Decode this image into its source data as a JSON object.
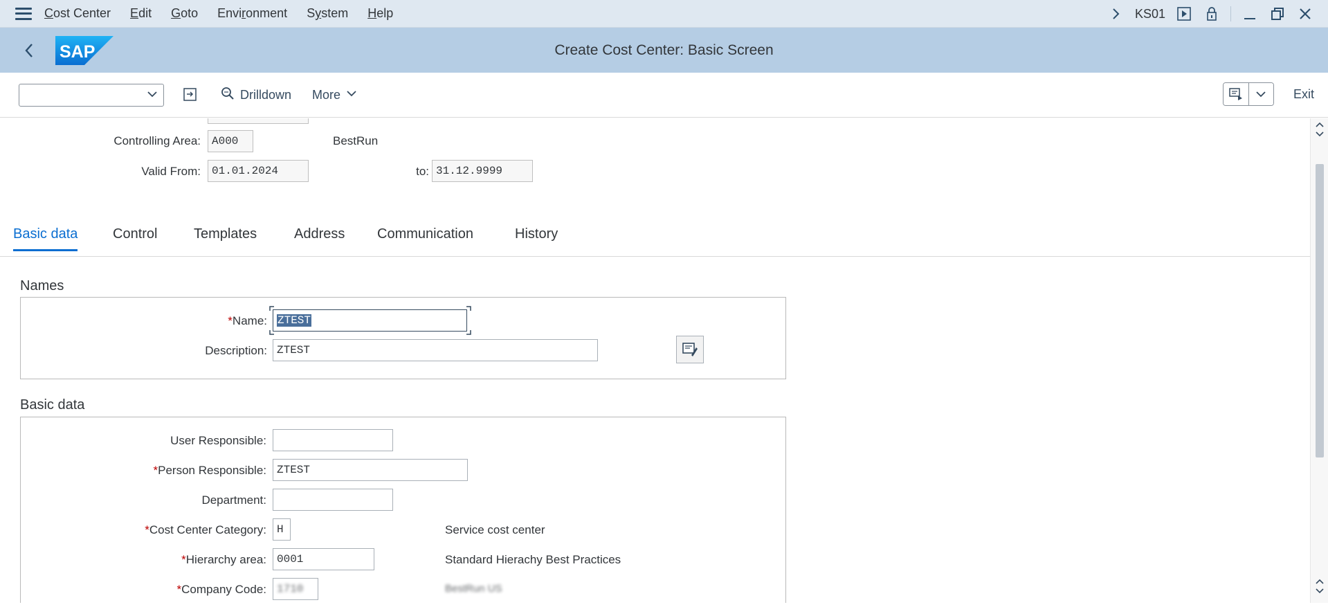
{
  "menubar": {
    "items": [
      {
        "underline": "C",
        "rest": "ost Center"
      },
      {
        "underline": "E",
        "rest": "dit"
      },
      {
        "underline": "G",
        "rest": "oto"
      },
      {
        "pre": "Envi",
        "underline": "r",
        "rest": "onment"
      },
      {
        "pre": "S",
        "underline": "y",
        "rest": "stem"
      },
      {
        "underline": "H",
        "rest": "elp"
      }
    ],
    "tcode": "KS01"
  },
  "shell": {
    "logo_text": "SAP",
    "title": "Create Cost Center: Basic Screen"
  },
  "toolbar": {
    "drilldown_label": "Drilldown",
    "more_label": "More",
    "exit_label": "Exit"
  },
  "header": {
    "controlling_area_label": "Controlling Area:",
    "controlling_area_value": "A000",
    "controlling_area_text": "BestRun",
    "valid_from_label": "Valid From:",
    "valid_from_value": "01.01.2024",
    "valid_to_label": "to:",
    "valid_to_value": "31.12.9999"
  },
  "tabs": [
    "Basic data",
    "Control",
    "Templates",
    "Address",
    "Communication",
    "History"
  ],
  "names_group": {
    "title": "Names",
    "name_label": "Name:",
    "name_value": "ZTEST",
    "description_label": "Description:",
    "description_value": "ZTEST"
  },
  "basic_group": {
    "title": "Basic data",
    "user_responsible_label": "User Responsible:",
    "user_responsible_value": "",
    "person_responsible_label": "Person Responsible:",
    "person_responsible_value": "ZTEST",
    "department_label": "Department:",
    "department_value": "",
    "category_label": "Cost Center Category:",
    "category_value": "H",
    "category_text": "Service cost center",
    "hierarchy_label": "Hierarchy area:",
    "hierarchy_value": "0001",
    "hierarchy_text": "Standard Hierachy Best Practices",
    "company_code_label": "Company Code:",
    "company_code_value": "1710",
    "company_code_text": "BestRun US"
  },
  "colors": {
    "menubar_bg": "#dfe8f1",
    "shell_bg": "#b5cde4",
    "accent": "#0a6ed1",
    "required": "#bb0000",
    "selection": "#4a6f9b"
  },
  "icons": [
    "menu-icon",
    "chevron-right-icon",
    "run-icon",
    "lock-icon",
    "minimize-icon",
    "restore-icon",
    "close-icon",
    "back-icon",
    "chevron-down-icon",
    "export-icon",
    "magnifier-icon",
    "customize-icon",
    "long-text-icon",
    "scroll-up-icon",
    "scroll-down-icon"
  ]
}
